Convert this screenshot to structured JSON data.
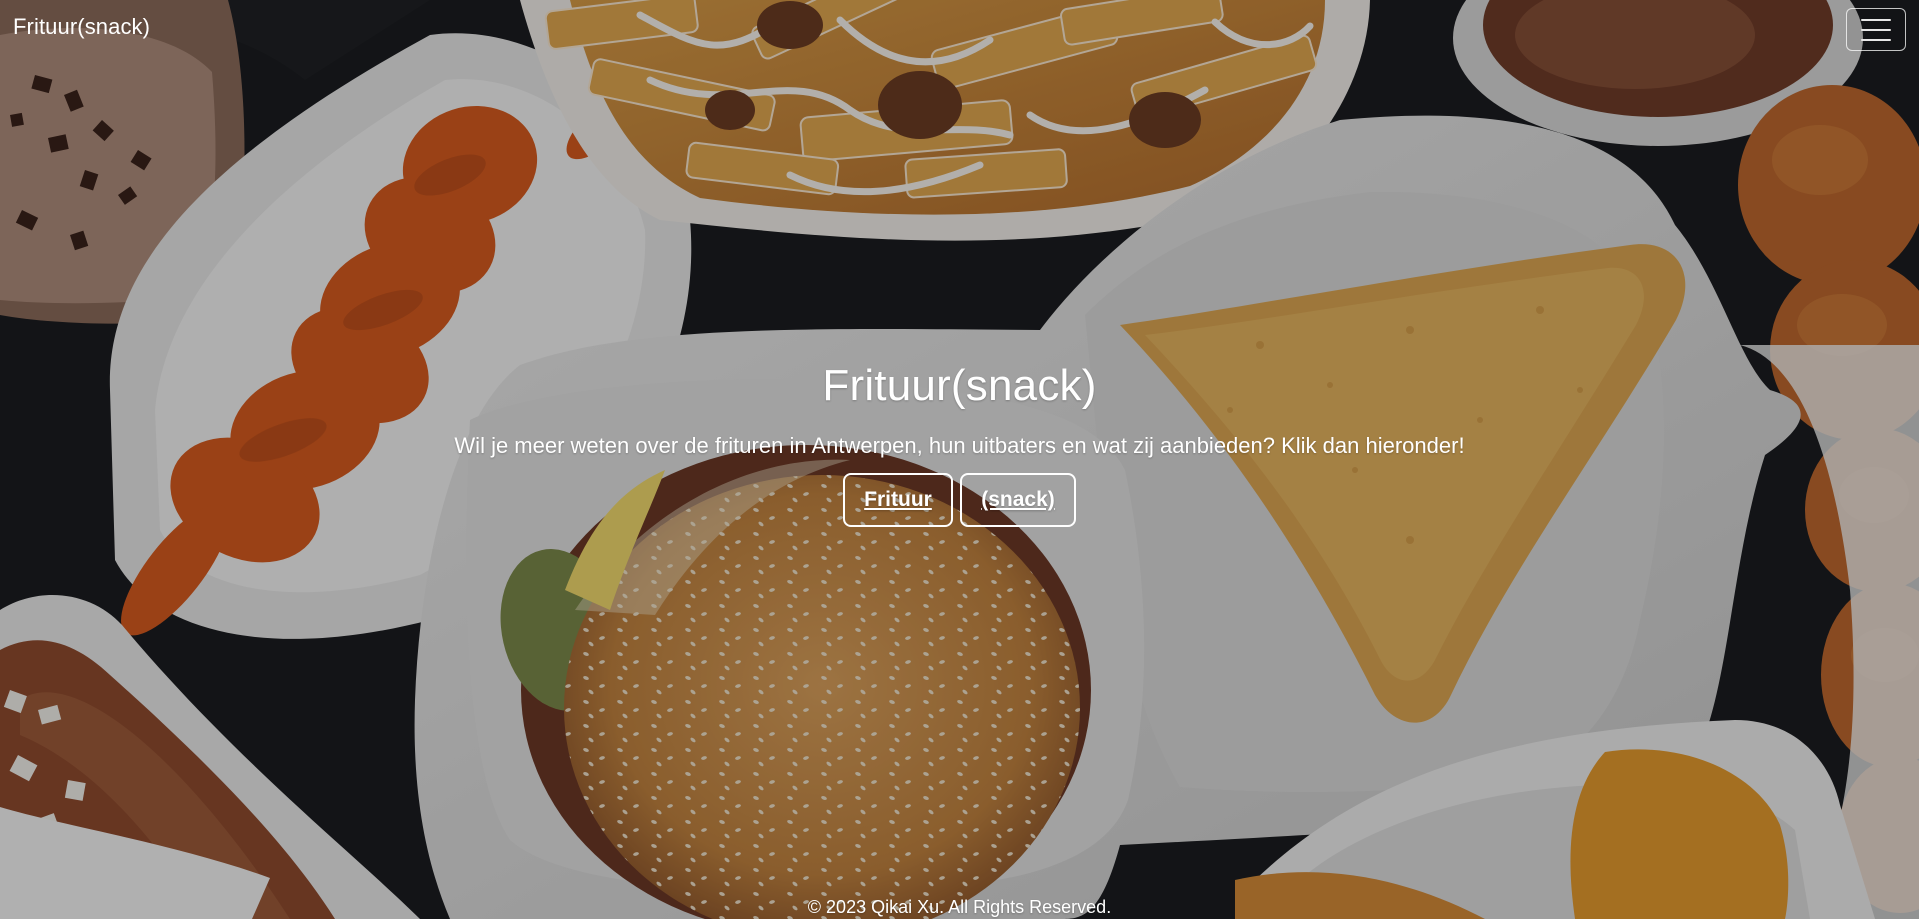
{
  "navbar": {
    "brand": "Frituur(snack)",
    "menu_icon": "hamburger-icon"
  },
  "hero": {
    "title": "Frituur(snack)",
    "subtitle": "Wil je meer weten over de frituren in Antwerpen, hun uitbaters en wat zij aanbieden? Klik dan hieronder!",
    "buttons": [
      {
        "label": "Frituur"
      },
      {
        "label": "(snack)"
      }
    ]
  },
  "footer": {
    "copyright": "© 2023 Qikai Xu. All Rights Reserved."
  },
  "colors": {
    "text": "#ffffff",
    "background": "#202124",
    "overlay": "rgba(0,0,0,0.28)"
  }
}
